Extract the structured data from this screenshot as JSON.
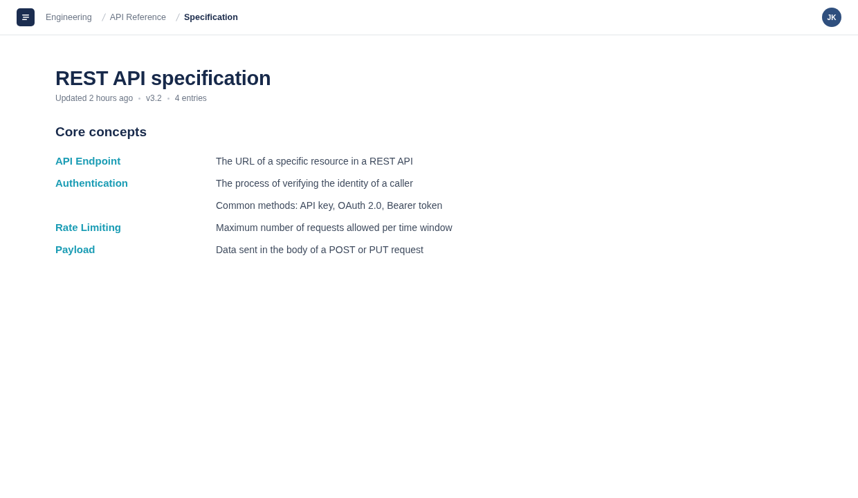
{
  "topbar": {
    "breadcrumbs": [
      {
        "label": "Engineering",
        "current": false
      },
      {
        "label": "API Reference",
        "current": false
      },
      {
        "label": "Specification",
        "current": true
      }
    ],
    "avatar": {
      "initials": "JK"
    }
  },
  "page": {
    "title": "REST API specification",
    "meta": [
      "Updated 2 hours ago",
      "v3.2",
      "4 entries"
    ],
    "section": {
      "heading": "Core concepts",
      "entries": [
        {
          "term": "API Endpoint",
          "definitions": [
            "The URL of a specific resource in a REST API"
          ]
        },
        {
          "term": "Authentication",
          "definitions": [
            "The process of verifying the identity of a caller",
            "Common methods: API key, OAuth 2.0, Bearer token"
          ]
        },
        {
          "term": "Rate Limiting",
          "definitions": [
            "Maximum number of requests allowed per time window"
          ]
        },
        {
          "term": "Payload",
          "definitions": [
            "Data sent in the body of a POST or PUT request"
          ]
        }
      ]
    }
  }
}
